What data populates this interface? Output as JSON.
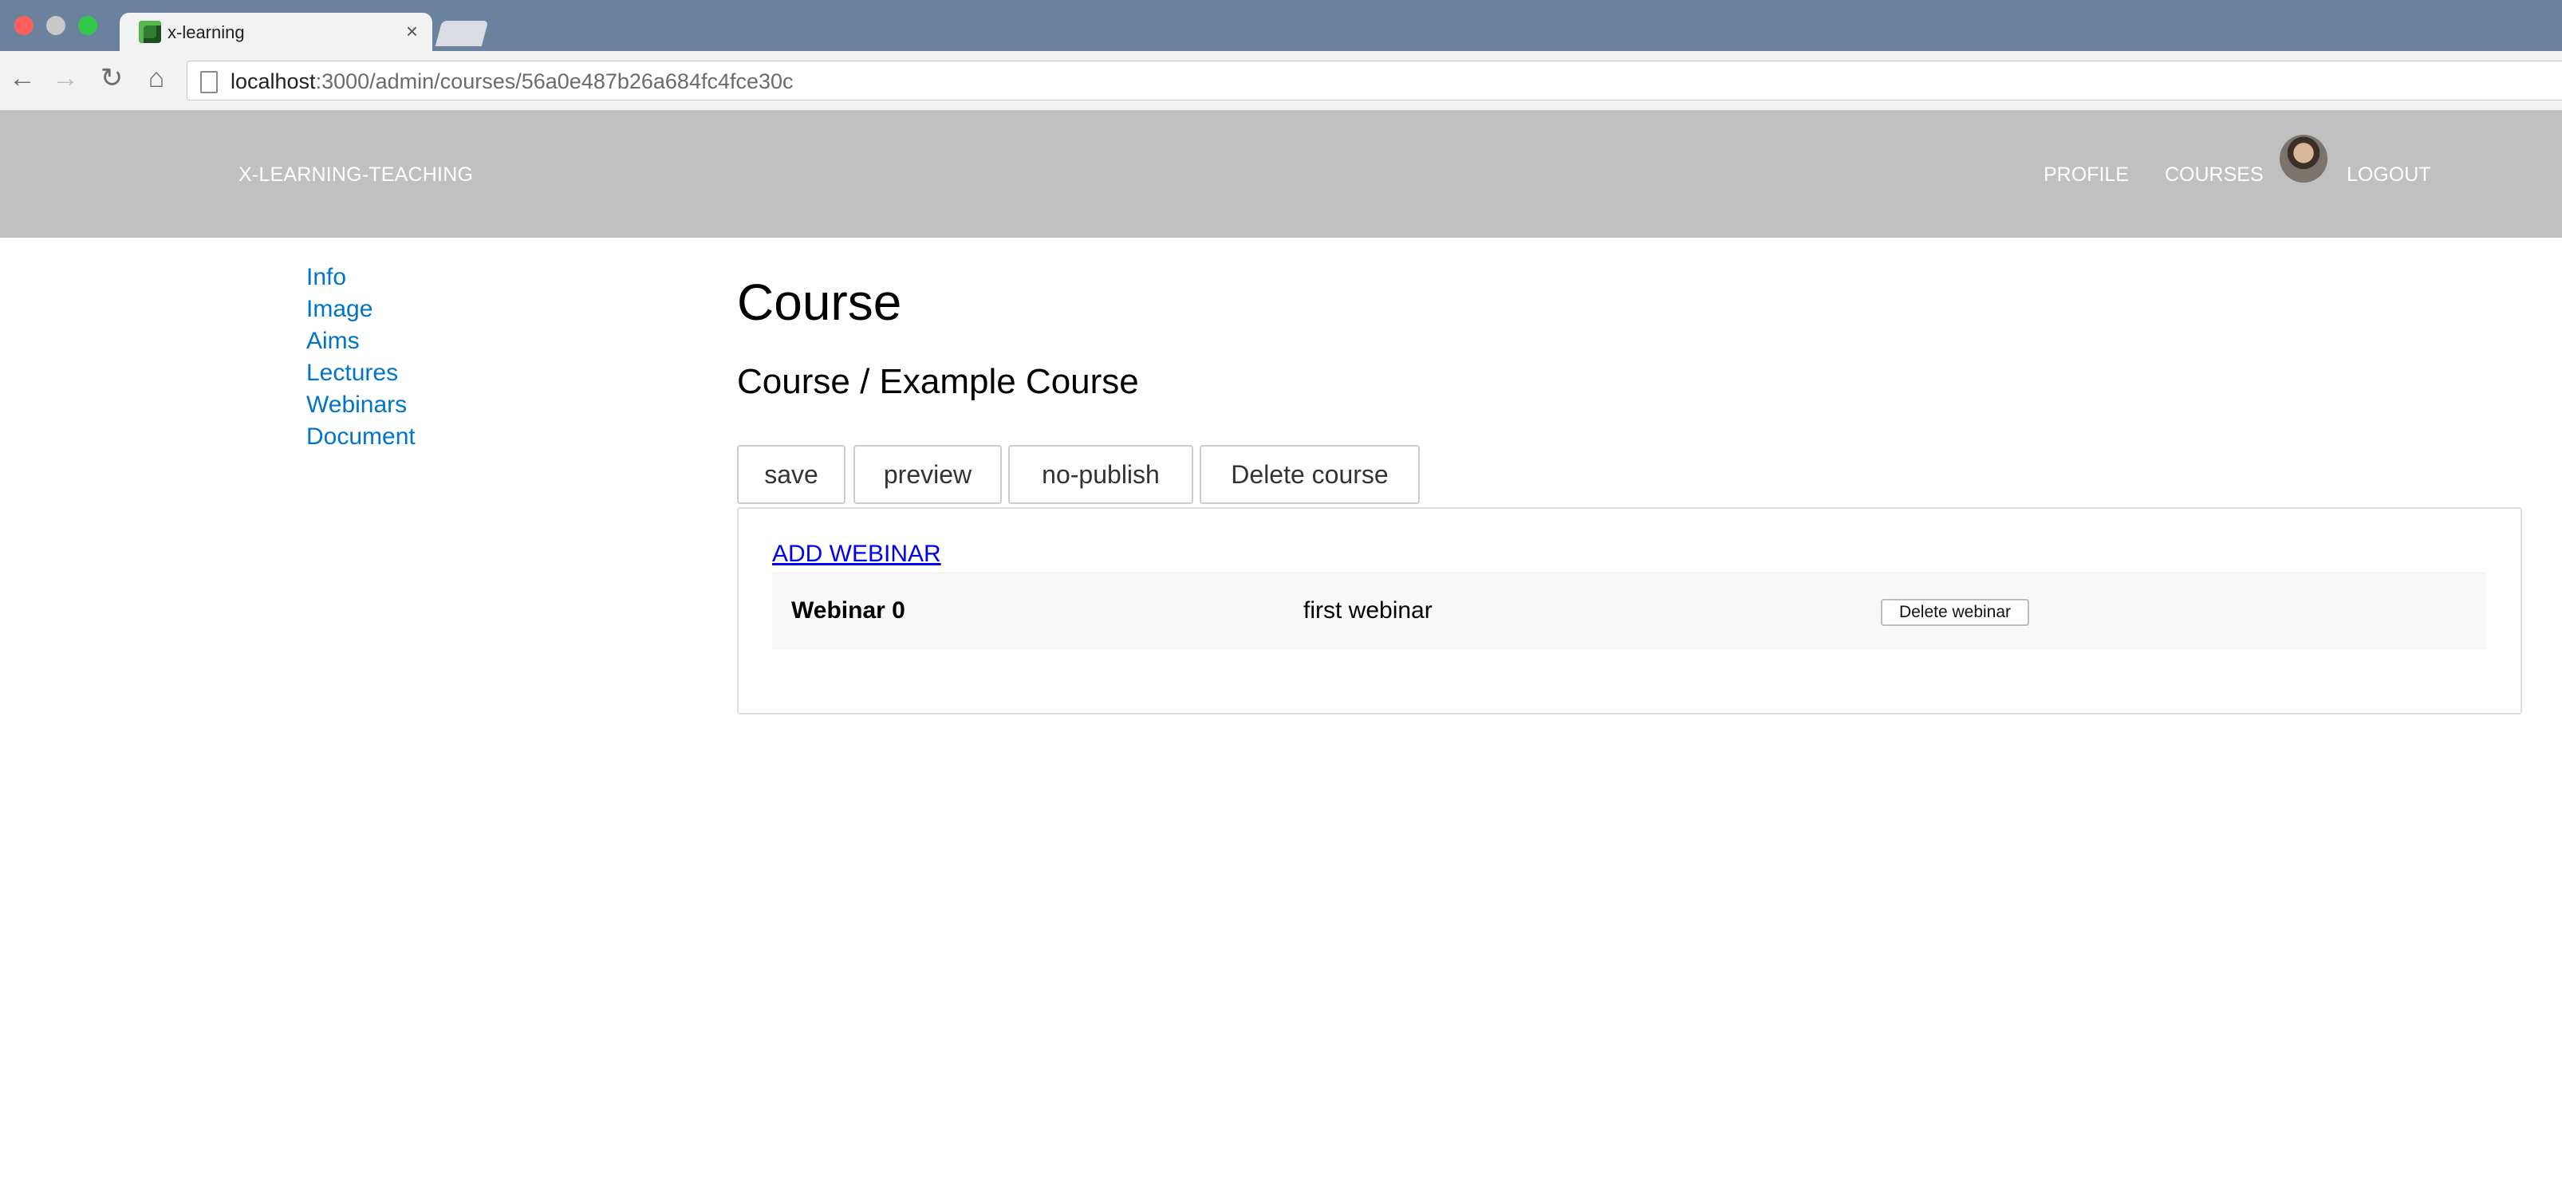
{
  "browser": {
    "tab_title": "x-learning",
    "tab_close": "×",
    "url_host": "localhost",
    "url_path": ":3000/admin/courses/56a0e487b26a684fc4fce30c",
    "icons": {
      "back": "arrow-left",
      "forward": "arrow-right",
      "reload": "reload",
      "home": "home"
    }
  },
  "header": {
    "brand": "X-LEARNING-TEACHING",
    "nav": {
      "profile": "PROFILE",
      "courses": "COURSES",
      "logout": "LOGOUT"
    },
    "colors": {
      "background": "#c0c0c0",
      "text": "#ffffff"
    }
  },
  "sidebar": {
    "items": [
      {
        "label": "Info"
      },
      {
        "label": "Image"
      },
      {
        "label": "Aims"
      },
      {
        "label": "Lectures"
      },
      {
        "label": "Webinars"
      },
      {
        "label": "Document"
      }
    ],
    "link_color": "#0074c8"
  },
  "main": {
    "title": "Course",
    "subtitle": "Course / Example Course",
    "actions": {
      "save": "save",
      "preview": "preview",
      "no_publish": "no-publish",
      "delete_course": "Delete course"
    },
    "panel": {
      "add_webinar": "ADD WEBINAR",
      "webinars": [
        {
          "name": "Webinar 0",
          "title": "first webinar",
          "delete_label": "Delete webinar"
        }
      ]
    }
  }
}
